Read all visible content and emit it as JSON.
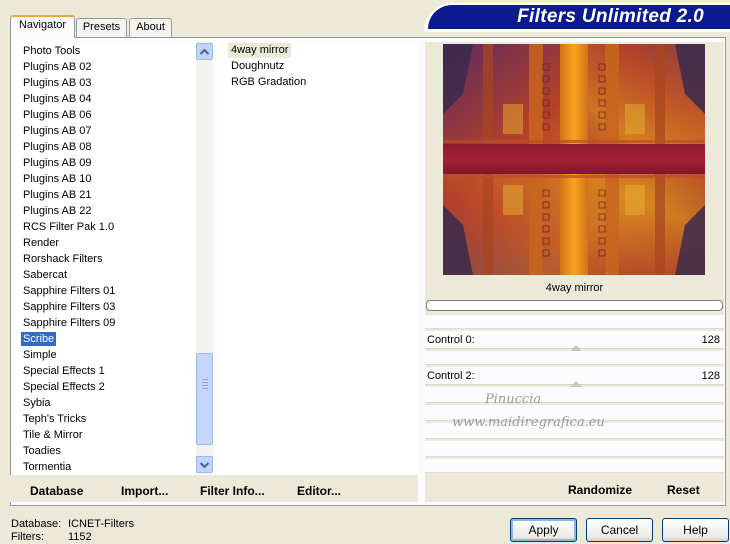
{
  "banner": {
    "title": "Filters Unlimited 2.0"
  },
  "tabs": [
    {
      "label": "Navigator",
      "active": true
    },
    {
      "label": "Presets",
      "active": false
    },
    {
      "label": "About",
      "active": false
    }
  ],
  "categories": {
    "items": [
      "Photo Tools",
      "Plugins AB 02",
      "Plugins AB 03",
      "Plugins AB 04",
      "Plugins AB 06",
      "Plugins AB 07",
      "Plugins AB 08",
      "Plugins AB 09",
      "Plugins AB 10",
      "Plugins AB 21",
      "Plugins AB 22",
      "RCS Filter Pak 1.0",
      "Render",
      "Rorshack Filters",
      "Sabercat",
      "Sapphire Filters 01",
      "Sapphire Filters 03",
      "Sapphire Filters 09",
      "Scribe",
      "Simple",
      "Special Effects 1",
      "Special Effects 2",
      "Sybia",
      "Teph's Tricks",
      "Tile & Mirror",
      "Toadies",
      "Tormentia"
    ],
    "selected": "Scribe"
  },
  "filters": {
    "items": [
      "4way mirror",
      "Doughnutz",
      "RGB Gradation"
    ],
    "selected": "4way mirror"
  },
  "left_buttons": {
    "database": "Database",
    "import": "Import...",
    "filter_info": "Filter Info...",
    "editor": "Editor..."
  },
  "preview": {
    "filter_name": "4way mirror"
  },
  "controls": [
    {
      "label": "Control 0:",
      "value": "128"
    },
    {
      "label": "Control 2:",
      "value": "128"
    }
  ],
  "watermark": {
    "line1": "Pinuccia",
    "line2": "www.maidiregrafica.eu"
  },
  "right_buttons": {
    "randomize": "Randomize",
    "reset": "Reset"
  },
  "status": {
    "database_label": "Database:",
    "database_value": "ICNET-Filters",
    "filters_label": "Filters:",
    "filters_value": "1152"
  },
  "dialog": {
    "apply": "Apply",
    "cancel": "Cancel",
    "help": "Help"
  },
  "colors": {
    "banner": "#0b1a8e",
    "selection": "#316ac5",
    "tab_highlight": "#f1a23a"
  }
}
